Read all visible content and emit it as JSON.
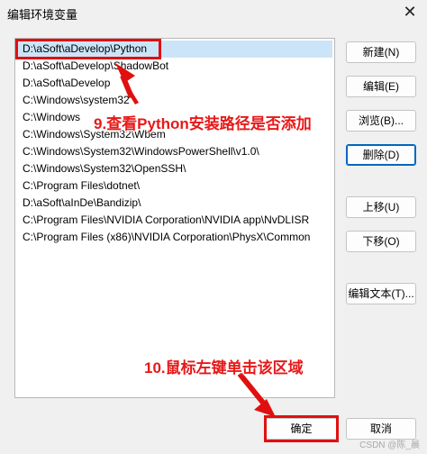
{
  "window": {
    "title": "编辑环境变量",
    "close_glyph": "✕"
  },
  "paths": [
    "D:\\aSoft\\aDevelop\\Python",
    "D:\\aSoft\\aDevelop\\ShadowBot",
    "D:\\aSoft\\aDevelop",
    "C:\\Windows\\system32",
    "C:\\Windows",
    "C:\\Windows\\System32\\Wbem",
    "C:\\Windows\\System32\\WindowsPowerShell\\v1.0\\",
    "C:\\Windows\\System32\\OpenSSH\\",
    "C:\\Program Files\\dotnet\\",
    "D:\\aSoft\\aInDe\\Bandizip\\",
    "C:\\Program Files\\NVIDIA Corporation\\NVIDIA app\\NvDLISR",
    "C:\\Program Files (x86)\\NVIDIA Corporation\\PhysX\\Common"
  ],
  "buttons": {
    "new": "新建(N)",
    "edit": "编辑(E)",
    "browse": "浏览(B)...",
    "delete": "删除(D)",
    "move_up": "上移(U)",
    "move_down": "下移(O)",
    "edit_text": "编辑文本(T)...",
    "ok": "确定",
    "cancel": "取消"
  },
  "annotations": {
    "step9": "9.查看Python安装路径是否添加",
    "step10": "10.鼠标左键单击该区域",
    "color": "#e01010"
  },
  "watermark": "CSDN @陈_晨"
}
